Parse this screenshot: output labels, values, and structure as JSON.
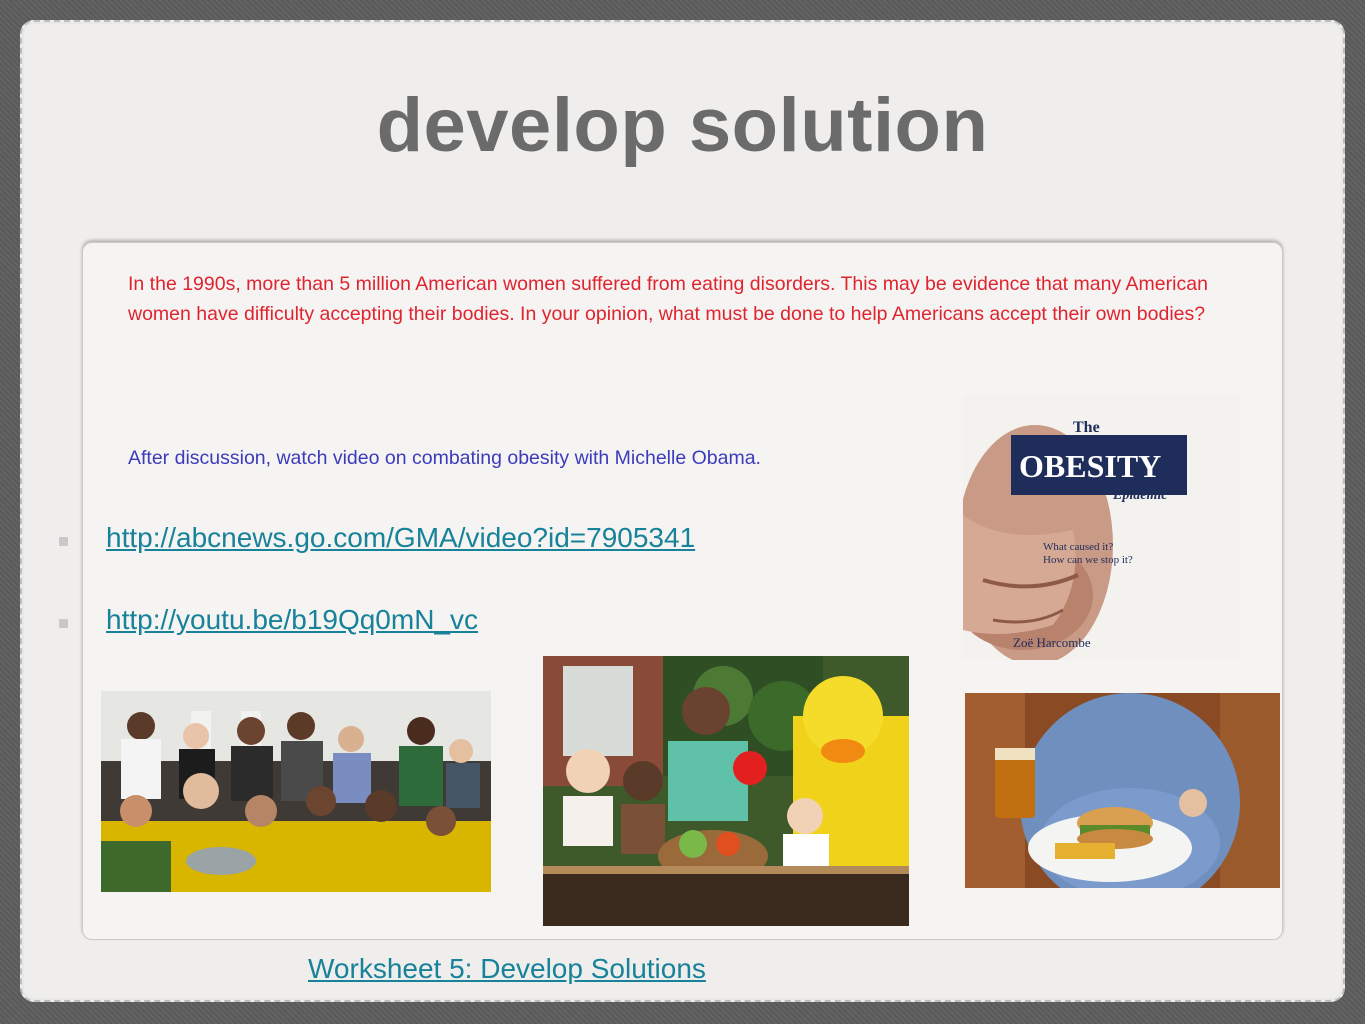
{
  "slide": {
    "title": "develop solution",
    "prompt": "In the 1990s, more than 5 million American women suffered from eating disorders. This may be evidence that many American women have difficulty accepting their bodies. In your opinion, what must be done to help Americans accept their own bodies?",
    "followup": "After discussion, watch video on combating obesity with Michelle Obama.",
    "links": [
      {
        "label": "http://abcnews.go.com/GMA/video?id=7905341"
      },
      {
        "label": "http://youtu.be/b19Qq0mN_vc"
      }
    ],
    "worksheet_link": "Worksheet 5:  Develop Solutions"
  },
  "book_cover": {
    "the": "The",
    "title": "OBESITY",
    "subtitle": "Epidemic",
    "question": "What caused it?\nHow can we stop it?",
    "author": "Zoë Harcombe"
  },
  "colors": {
    "title": "#6b6b6b",
    "prompt": "#e0242f",
    "followup": "#3b3bbd",
    "link": "#17829a",
    "book_navy": "#1f2d5a"
  }
}
